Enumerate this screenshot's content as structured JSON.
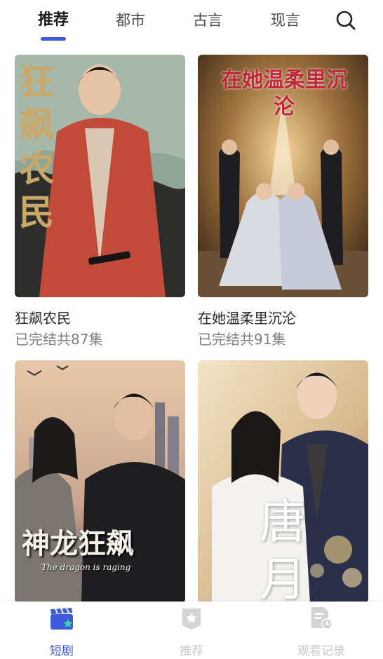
{
  "tabs": [
    {
      "label": "推荐"
    },
    {
      "label": "都市"
    },
    {
      "label": "古言"
    },
    {
      "label": "现言"
    }
  ],
  "active_tab": "推荐",
  "search_icon": "search-icon",
  "colors": {
    "accent": "#3e5bdc",
    "nav_inactive": "#c8c8c8",
    "status_text": "#808080"
  },
  "dramas": [
    {
      "title": "狂飙农民",
      "status": "已完结共87集",
      "poster_text": "狂飙农民"
    },
    {
      "title": "在她温柔里沉沦",
      "status": "已完结共91集",
      "poster_text": "在她温柔里沉沦"
    },
    {
      "title": "",
      "status": "",
      "poster_text": "神龙狂飙",
      "poster_subtext": "The dragon is raging"
    },
    {
      "title": "",
      "status": "",
      "poster_text": "唐月"
    }
  ],
  "bottom_nav": [
    {
      "label": "短剧",
      "icon": "clapperboard-icon"
    },
    {
      "label": "推荐",
      "icon": "star-badge-icon"
    },
    {
      "label": "观看记录",
      "icon": "history-document-icon"
    }
  ]
}
